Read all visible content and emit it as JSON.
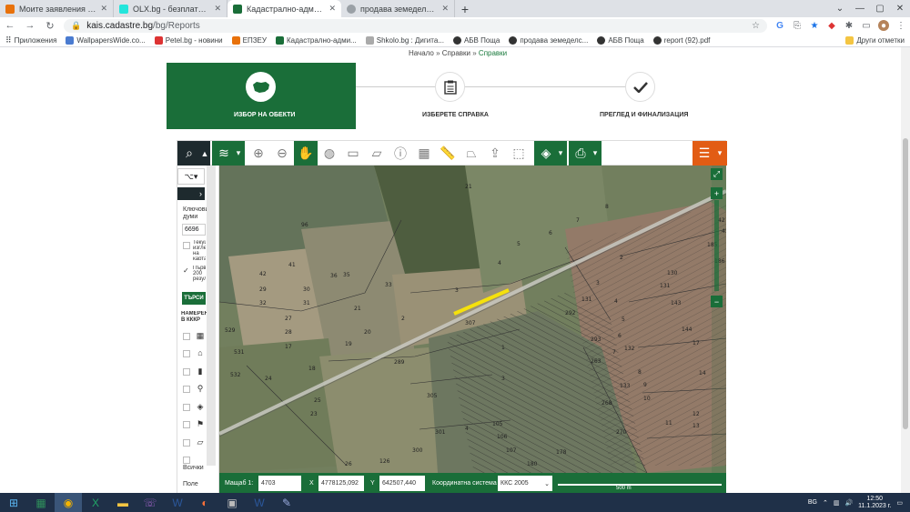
{
  "browser": {
    "tabs": [
      {
        "title": "Моите заявления - ЕПЗЕУ",
        "color": "#e8710a"
      },
      {
        "title": "OLX.bg - безплатни обяви",
        "color": "#23e5db"
      },
      {
        "title": "Кадастрално-административна",
        "color": "#1a6e39"
      },
      {
        "title": "продава земеделска земя",
        "color": "#5f6368"
      }
    ],
    "new_tab": "+",
    "url_host": "kais.cadastre.bg",
    "url_path": "/bg/Reports",
    "bookmarks": [
      {
        "label": "Приложения",
        "color": "#5f6368"
      },
      {
        "label": "WallpapersWide.co...",
        "color": "#4a7bd0"
      },
      {
        "label": "Petel.bg - новини",
        "color": "#d33"
      },
      {
        "label": "ЕПЗЕУ",
        "color": "#e8710a"
      },
      {
        "label": "Кадастрално-адми...",
        "color": "#1a6e39"
      },
      {
        "label": "Shkolo.bg : Дигита...",
        "color": "#999"
      },
      {
        "label": "АБВ Поща",
        "color": "#333"
      },
      {
        "label": "продава земеделс...",
        "color": "#333"
      },
      {
        "label": "АБВ Поща",
        "color": "#333"
      },
      {
        "label": "report (92).pdf",
        "color": "#333"
      }
    ],
    "other_bookmarks": "Други отметки"
  },
  "page": {
    "breadcrumb": [
      "Начало",
      "Справки",
      "Справки"
    ],
    "steps": [
      {
        "label": "ИЗБОР НА ОБЕКТИ"
      },
      {
        "label": "ИЗБЕРЕТЕ СПРАВКА"
      },
      {
        "label": "ПРЕГЛЕД И ФИНАЛИЗАЦИЯ"
      }
    ]
  },
  "sidepanel": {
    "keywords_label": "Ключови думи",
    "keywords_value": "6696",
    "check1": "Текущ изглед на картата",
    "check2": "Първите 200 резултата",
    "search_button": "ТЪРСИ",
    "found_label": "НАМЕРЕНИ В КККР",
    "all_label": "Всички",
    "col_label": "Поле"
  },
  "parcel_labels": [
    {
      "t": "21"
    },
    {
      "t": "96"
    },
    {
      "t": "41"
    },
    {
      "t": "42"
    },
    {
      "t": "29"
    },
    {
      "t": "32"
    },
    {
      "t": "36"
    },
    {
      "t": "35"
    },
    {
      "t": "30"
    },
    {
      "t": "31"
    },
    {
      "t": "27"
    },
    {
      "t": "28"
    },
    {
      "t": "17"
    },
    {
      "t": "529"
    },
    {
      "t": "531"
    },
    {
      "t": "532"
    },
    {
      "t": "24"
    },
    {
      "t": "18"
    },
    {
      "t": "19"
    },
    {
      "t": "20"
    },
    {
      "t": "21"
    },
    {
      "t": "33"
    },
    {
      "t": "2"
    },
    {
      "t": "3"
    },
    {
      "t": "4"
    },
    {
      "t": "5"
    },
    {
      "t": "6"
    },
    {
      "t": "7"
    },
    {
      "t": "8"
    },
    {
      "t": "2"
    },
    {
      "t": "3"
    },
    {
      "t": "4"
    },
    {
      "t": "5"
    },
    {
      "t": "6"
    },
    {
      "t": "7"
    },
    {
      "t": "8"
    },
    {
      "t": "9"
    },
    {
      "t": "10"
    },
    {
      "t": "11"
    },
    {
      "t": "12"
    },
    {
      "t": "13"
    },
    {
      "t": "14"
    },
    {
      "t": "17"
    },
    {
      "t": "130"
    },
    {
      "t": "131"
    },
    {
      "t": "132"
    },
    {
      "t": "133"
    },
    {
      "t": "143"
    },
    {
      "t": "144"
    },
    {
      "t": "185"
    },
    {
      "t": "186"
    },
    {
      "t": "307"
    },
    {
      "t": "289"
    },
    {
      "t": "305"
    },
    {
      "t": "300"
    },
    {
      "t": "301"
    },
    {
      "t": "126"
    },
    {
      "t": "25"
    },
    {
      "t": "23"
    },
    {
      "t": "26"
    },
    {
      "t": "263"
    },
    {
      "t": "268"
    },
    {
      "t": "270"
    },
    {
      "t": "274"
    },
    {
      "t": "234"
    },
    {
      "t": "292"
    },
    {
      "t": "293"
    },
    {
      "t": "105"
    },
    {
      "t": "106"
    },
    {
      "t": "107"
    },
    {
      "t": "180"
    },
    {
      "t": "178"
    },
    {
      "t": "131"
    },
    {
      "t": "42"
    },
    {
      "t": "43"
    },
    {
      "t": "1"
    },
    {
      "t": "3"
    },
    {
      "t": "4"
    }
  ],
  "status": {
    "scale_label": "Мащаб 1:",
    "scale_value": "4703",
    "x_label": "X",
    "x_value": "4778125,092",
    "y_label": "Y",
    "y_value": "642507,440",
    "crs_label": "Координатна система",
    "crs_value": "ККС 2005",
    "scalebar": "500 m"
  },
  "taskbar": {
    "time": "12:50",
    "date": "11.1.2023 г.",
    "lang": "BG"
  },
  "colors": {
    "brand_green": "#1a6e39",
    "accent_orange": "#e25c14",
    "highlight_yellow": "#f5e10c"
  }
}
